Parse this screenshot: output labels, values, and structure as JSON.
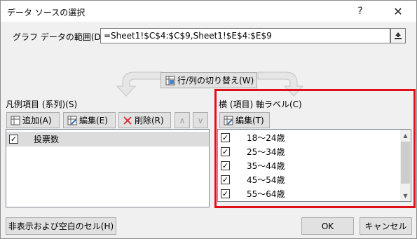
{
  "window": {
    "title": "データ ソースの選択",
    "help": "?",
    "close": "✕"
  },
  "data_range": {
    "label": "グラフ データの範囲(D):",
    "value": "=Sheet1!$C$4:$C$9,Sheet1!$E$4:$E$9",
    "collapse_icon": "range-select-icon"
  },
  "switch_button": {
    "label": "行/列の切り替え(W)"
  },
  "legend_entries": {
    "label": "凡例項目 (系列)(S)",
    "buttons": {
      "add": "追加(A)",
      "edit": "編集(E)",
      "remove": "削除(R)",
      "move_up": "∧",
      "move_down": "∨"
    },
    "items": [
      {
        "label": "投票数",
        "checked": true
      }
    ]
  },
  "axis_labels": {
    "label": "横 (項目) 軸ラベル(C)",
    "edit_button": "編集(T)",
    "items": [
      {
        "label": "18～24歳",
        "checked": true
      },
      {
        "label": "25～34歳",
        "checked": true
      },
      {
        "label": "35～44歳",
        "checked": true
      },
      {
        "label": "45～54歳",
        "checked": true
      },
      {
        "label": "55～64歳",
        "checked": true
      }
    ]
  },
  "footer": {
    "hidden_cells": "非表示および空白のセル(H)",
    "ok": "OK",
    "cancel": "キャンセル"
  },
  "colors": {
    "highlight": "#e0101a",
    "remove_icon": "#d9232d"
  }
}
